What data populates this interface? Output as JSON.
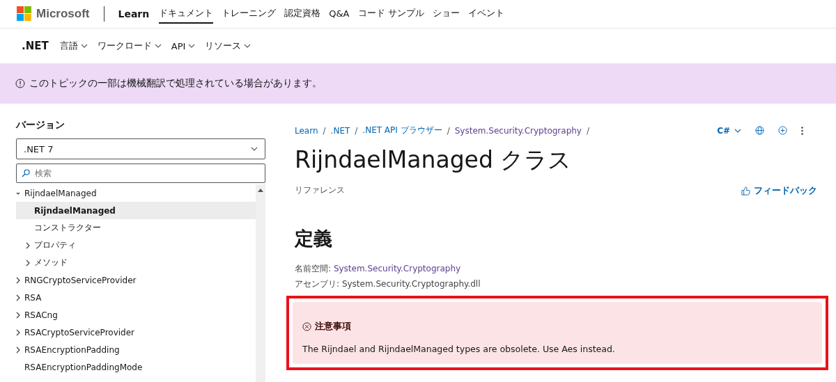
{
  "header": {
    "brand": "Microsoft",
    "product": "Learn",
    "nav": [
      {
        "label": "ドキュメント",
        "selected": true
      },
      {
        "label": "トレーニング",
        "selected": false
      },
      {
        "label": "認定資格",
        "selected": false
      },
      {
        "label": "Q&A",
        "selected": false
      },
      {
        "label": "コード サンプル",
        "selected": false
      },
      {
        "label": "ショー",
        "selected": false
      },
      {
        "label": "イベント",
        "selected": false
      }
    ]
  },
  "subnav": {
    "title": ".NET",
    "items": [
      "言語",
      "ワークロード",
      "API",
      "リソース"
    ]
  },
  "banner": {
    "text": "このトピックの一部は機械翻訳で処理されている場合があります。"
  },
  "sidebar": {
    "heading": "バージョン",
    "version": ".NET 7",
    "search_placeholder": "検索",
    "tree": [
      {
        "label": "RijndaelManaged",
        "selected": false,
        "expanded": true,
        "children": [
          {
            "label": "RijndaelManaged",
            "selected": true
          },
          {
            "label": "コンストラクター",
            "selected": false
          },
          {
            "label": "プロパティ",
            "selected": false,
            "expanded": false
          },
          {
            "label": "メソッド",
            "selected": false,
            "expanded": false
          }
        ]
      },
      {
        "label": "RNGCryptoServiceProvider",
        "selected": false,
        "expanded": false
      },
      {
        "label": "RSA",
        "selected": false,
        "expanded": false
      },
      {
        "label": "RSACng",
        "selected": false,
        "expanded": false
      },
      {
        "label": "RSACryptoServiceProvider",
        "selected": false,
        "expanded": false
      },
      {
        "label": "RSAEncryptionPadding",
        "selected": false,
        "expanded": false
      },
      {
        "label": "RSAEncryptionPaddingMode",
        "selected": false
      }
    ]
  },
  "breadcrumb": [
    {
      "label": "Learn",
      "visited": false,
      "separator": "/"
    },
    {
      "label": ".NET",
      "visited": false,
      "separator": "/"
    },
    {
      "label": ".NET API ブラウザー",
      "visited": false,
      "separator": "/"
    },
    {
      "label": "System.Security.Cryptography",
      "visited": true,
      "separator": "/"
    }
  ],
  "language": "C#",
  "title": "RijndaelManaged クラス",
  "subtitle": "リファレンス",
  "feedback": "フィードバック",
  "definition": {
    "heading": "定義",
    "namespace_label": "名前空間:",
    "namespace": "System.Security.Cryptography",
    "assembly_label": "アセンブリ:",
    "assembly": "System.Security.Cryptography.dll"
  },
  "alert": {
    "title": "注意事項",
    "text": "The Rijndael and RijndaelManaged types are obsolete. Use Aes instead."
  }
}
